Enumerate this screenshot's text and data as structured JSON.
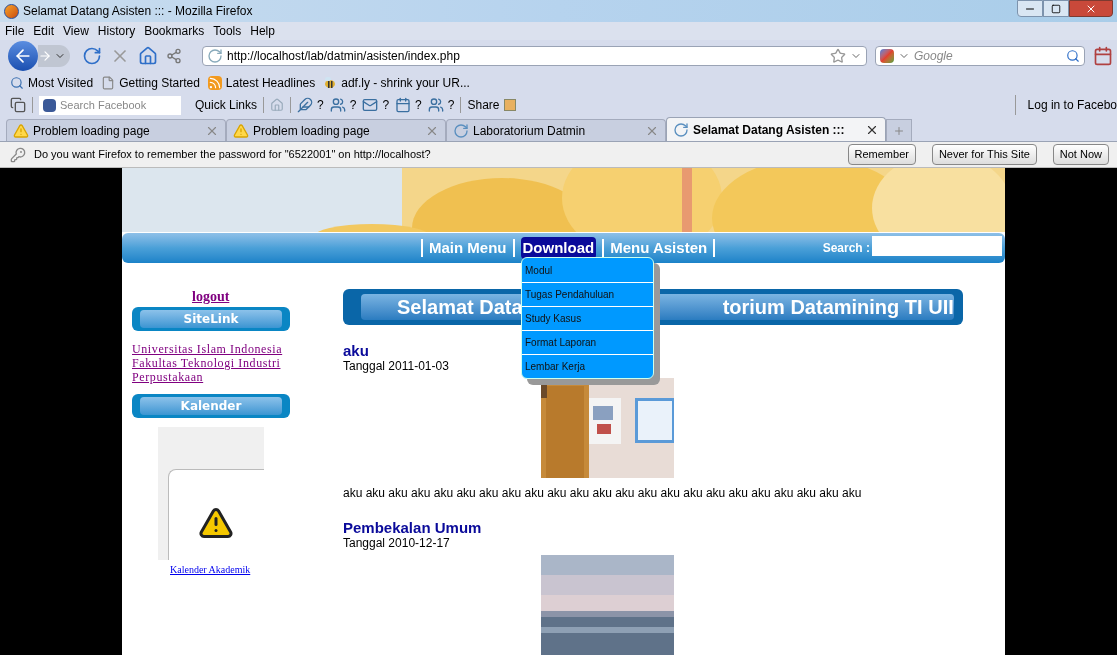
{
  "window": {
    "title": "Selamat Datang Asisten ::: - Mozilla Firefox"
  },
  "menu_bar": [
    "File",
    "Edit",
    "View",
    "History",
    "Bookmarks",
    "Tools",
    "Help"
  ],
  "address_bar": {
    "value": "http://localhost/lab/datmin/asisten/index.php"
  },
  "search_field": {
    "placeholder": "Google"
  },
  "bookmarks": [
    {
      "label": "Most Visited",
      "kind": "search"
    },
    {
      "label": "Getting Started",
      "kind": "page"
    },
    {
      "label": "Latest Headlines",
      "kind": "feed"
    },
    {
      "label": "adf.ly - shrink your UR...",
      "kind": "bee"
    }
  ],
  "facebook_toolbar": {
    "search_placeholder": "Search Facebook",
    "quick_links": "Quick Links",
    "counts": [
      "?",
      "?",
      "?",
      "?",
      "?"
    ],
    "share": "Share",
    "login": "Log in to Facebo"
  },
  "tabs": [
    {
      "label": "Problem loading page",
      "selected": false,
      "kind": "warning"
    },
    {
      "label": "Problem loading page",
      "selected": false,
      "kind": "warning"
    },
    {
      "label": "Laboratorium Datmin",
      "selected": false,
      "kind": "loading"
    },
    {
      "label": "Selamat Datang Asisten :::",
      "selected": true,
      "kind": "loading"
    }
  ],
  "notification": {
    "message": "Do you want Firefox to remember the password for \"6522001\" on http://localhost?",
    "buttons": [
      "Remember",
      "Never for This Site",
      "Not Now"
    ]
  },
  "page": {
    "nav": [
      {
        "label": "Main Menu",
        "selected": false
      },
      {
        "label": "Download",
        "selected": true
      },
      {
        "label": "Menu Asisten",
        "selected": false
      }
    ],
    "search_label": "Search :",
    "dropdown": [
      "Modul",
      "Tugas Pendahuluan",
      "Study Kasus",
      "Format Laporan",
      "Lembar Kerja"
    ],
    "logout": "logout",
    "sitelink_heading": "SiteLink",
    "links": [
      "Universitas Islam Indonesia",
      "Fakultas Teknologi Industri",
      "Perpustakaan"
    ],
    "calendar_heading": "Kalender",
    "calendar_link": "Kalender Akademik",
    "banner_parts": [
      "Selamat Data",
      "torium Datamining TI UII"
    ],
    "posts": [
      {
        "title": "aku",
        "date": "Tanggal 2011-01-03",
        "body": "aku aku aku aku aku aku aku aku aku aku aku aku aku aku aku aku aku aku aku aku aku aku aku"
      },
      {
        "title": "Pembekalan Umum",
        "date": "Tanggal 2010-12-17"
      }
    ]
  }
}
